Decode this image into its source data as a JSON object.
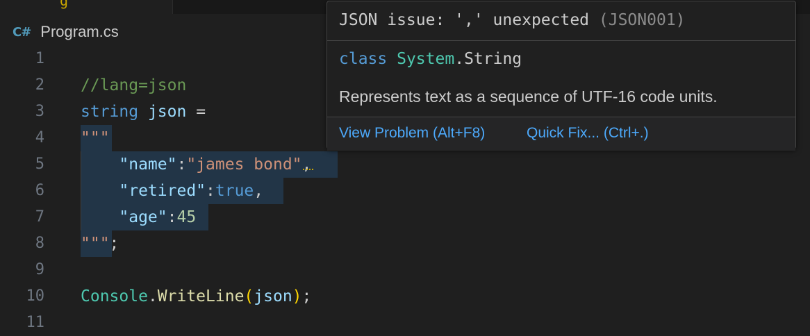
{
  "editor": {
    "tab_fragment": "g",
    "breadcrumb": {
      "icon": "csharp-file-icon",
      "icon_text": "C#",
      "file": "Program.cs"
    },
    "lines": [
      {
        "num": "1",
        "tokens": []
      },
      {
        "num": "2",
        "tokens": [
          {
            "t": "//lang=json",
            "c": "c-comment"
          }
        ]
      },
      {
        "num": "3",
        "tokens": [
          {
            "t": "string",
            "c": "c-kw"
          },
          {
            "t": " ",
            "c": "c-punc"
          },
          {
            "t": "json",
            "c": "c-var"
          },
          {
            "t": " =",
            "c": "c-punc"
          }
        ]
      },
      {
        "num": "4",
        "tokens": [
          {
            "t": "\"\"\"",
            "c": "c-str"
          }
        ]
      },
      {
        "num": "5",
        "tokens": [
          {
            "t": "    ",
            "c": "c-punc"
          },
          {
            "t": "\"name\"",
            "c": "c-prop"
          },
          {
            "t": ":",
            "c": "c-punc"
          },
          {
            "t": "\"james bond\"",
            "c": "c-str"
          },
          {
            "t": ",",
            "c": "c-punc squiggle"
          }
        ]
      },
      {
        "num": "6",
        "tokens": [
          {
            "t": "    ",
            "c": "c-punc"
          },
          {
            "t": "\"retired\"",
            "c": "c-prop"
          },
          {
            "t": ":",
            "c": "c-punc"
          },
          {
            "t": "true",
            "c": "c-kw"
          },
          {
            "t": ",",
            "c": "c-punc"
          }
        ]
      },
      {
        "num": "7",
        "tokens": [
          {
            "t": "    ",
            "c": "c-punc"
          },
          {
            "t": "\"age\"",
            "c": "c-prop"
          },
          {
            "t": ":",
            "c": "c-punc"
          },
          {
            "t": "45",
            "c": "c-num"
          }
        ]
      },
      {
        "num": "8",
        "tokens": [
          {
            "t": "\"\"\"",
            "c": "c-str"
          },
          {
            "t": ";",
            "c": "c-punc"
          }
        ]
      },
      {
        "num": "9",
        "tokens": []
      },
      {
        "num": "10",
        "tokens": [
          {
            "t": "Console",
            "c": "c-type"
          },
          {
            "t": ".",
            "c": "c-punc"
          },
          {
            "t": "WriteLine",
            "c": "c-method"
          },
          {
            "t": "(",
            "c": "c-paren"
          },
          {
            "t": "json",
            "c": "c-var"
          },
          {
            "t": ")",
            "c": "c-paren"
          },
          {
            "t": ";",
            "c": "c-punc"
          }
        ]
      },
      {
        "num": "11",
        "tokens": []
      }
    ]
  },
  "hover": {
    "message": "JSON issue: ',' unexpected",
    "code": "(JSON001)",
    "sig_keyword": "class",
    "sig_type": "System",
    "sig_dot": ".",
    "sig_name": "String",
    "description": "Represents text as a sequence of UTF-16 code units.",
    "view_problem": "View Problem (Alt+F8)",
    "quick_fix": "Quick Fix... (Ctrl+.)"
  },
  "colors": {
    "background": "#1f1f1f",
    "selection": "#264f78",
    "warning": "#cca700",
    "link": "#4daafc"
  }
}
